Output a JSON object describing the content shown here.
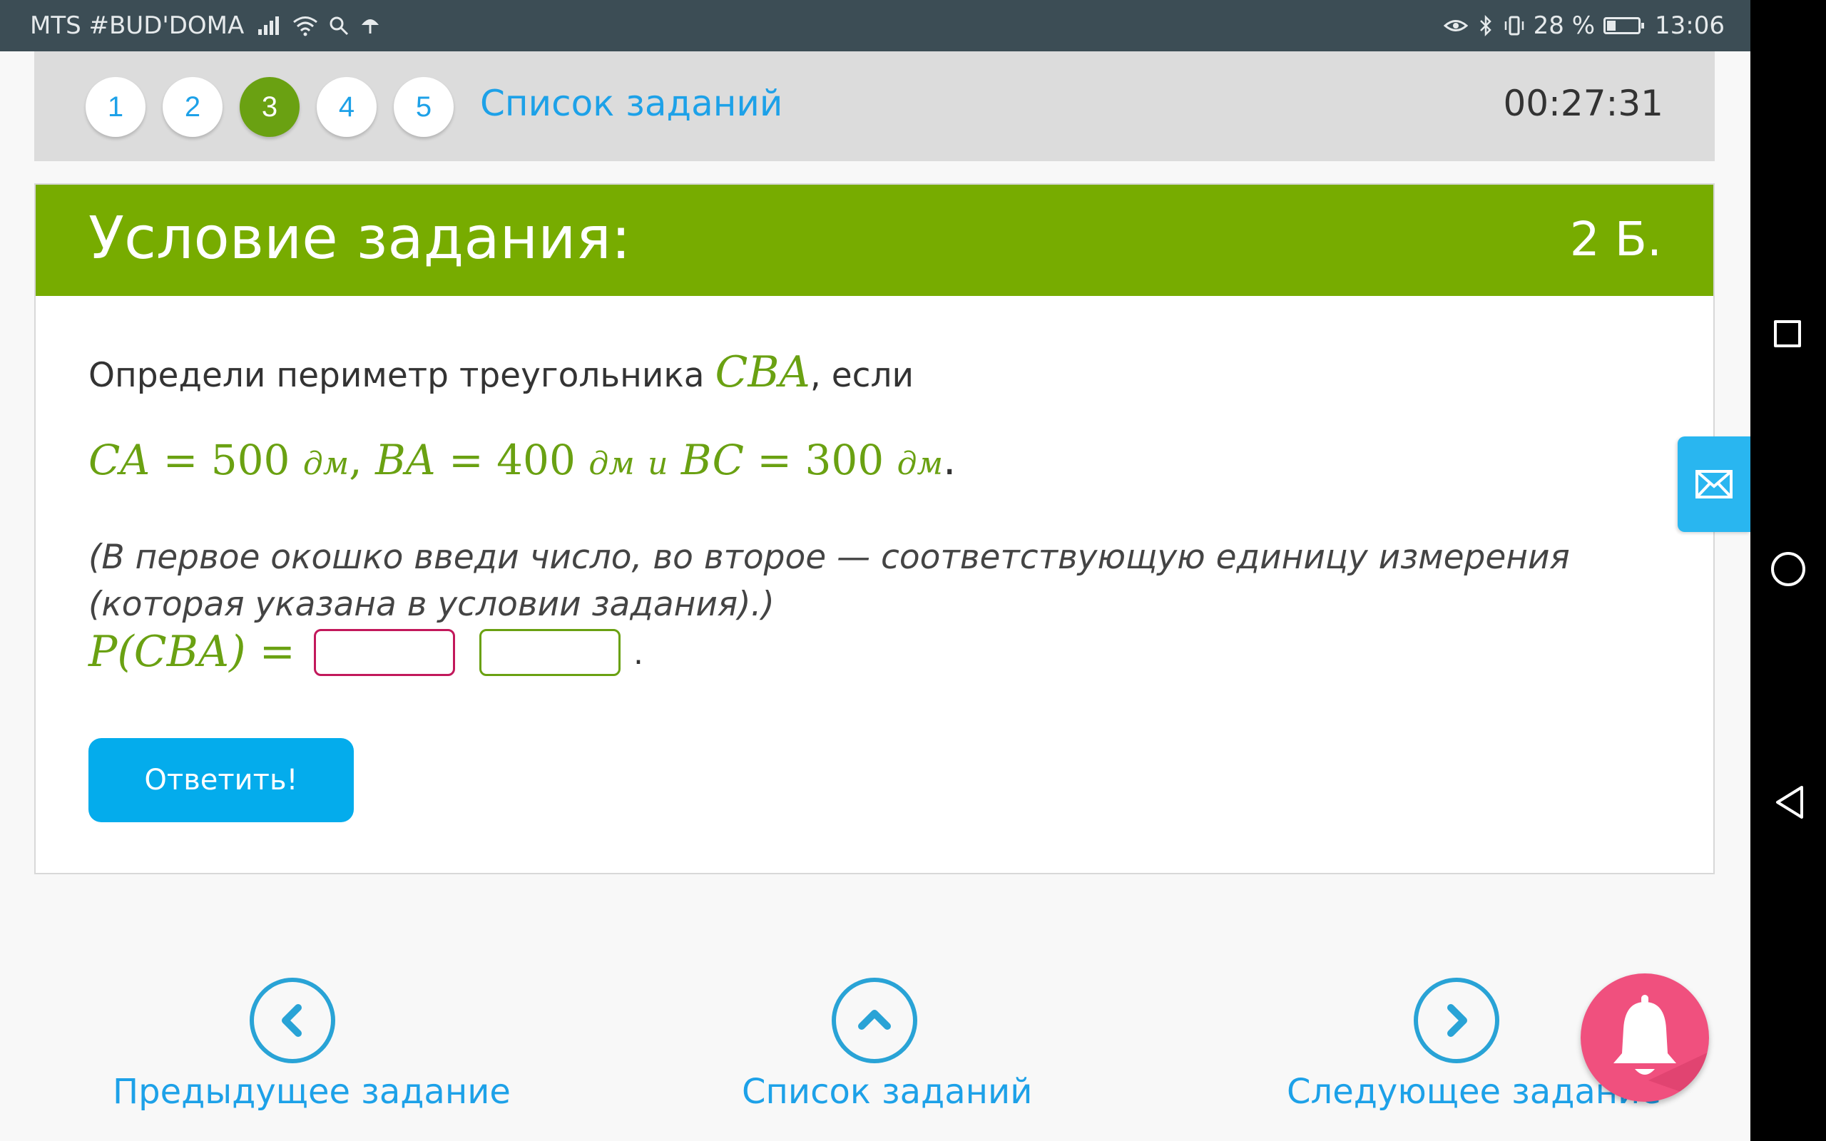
{
  "status_bar": {
    "carrier": "MTS #BUD'DOMA",
    "battery_percent": "28 %",
    "battery_level": 0.28,
    "time": "13:06"
  },
  "top_bar": {
    "steps": [
      "1",
      "2",
      "3",
      "4",
      "5"
    ],
    "active_step": "3",
    "task_list_link": "Список заданий",
    "timer": "00:27:31"
  },
  "task": {
    "header_title": "Условие задания:",
    "points": "2 Б.",
    "question_prefix": "Определи периметр треугольника ",
    "triangle_name": "CBA",
    "question_suffix": ", если",
    "conditions": {
      "ca_label": "CA",
      "ca_value": "500",
      "ba_label": "BA",
      "ba_value": "400",
      "bc_label": "BC",
      "bc_value": "300",
      "unit": "дм",
      "and_word": "и"
    },
    "hint": "(В первое окошко введи число, во второе — соответствующую единицу измерения (которая указана в условии задания).)",
    "formula_label": "P(CBA) =",
    "answer_number_value": "",
    "answer_unit_value": "",
    "end_period": ".",
    "submit_button": "Ответить!"
  },
  "bottom_nav": {
    "prev_label": "Предыдущее задание",
    "list_label": "Список заданий",
    "next_label": "Следующее задание"
  },
  "colors": {
    "accent_green": "#77ac00",
    "link_blue": "#1da1e8",
    "button_blue": "#04acec",
    "bell_pink": "#f0507e",
    "number_box_border": "#c2185b",
    "unit_box_border": "#6aa112"
  },
  "icons": {
    "mail": "envelope-icon",
    "bell": "bell-icon",
    "prev": "chevron-left-icon",
    "list": "chevron-up-icon",
    "next": "chevron-right-icon"
  }
}
